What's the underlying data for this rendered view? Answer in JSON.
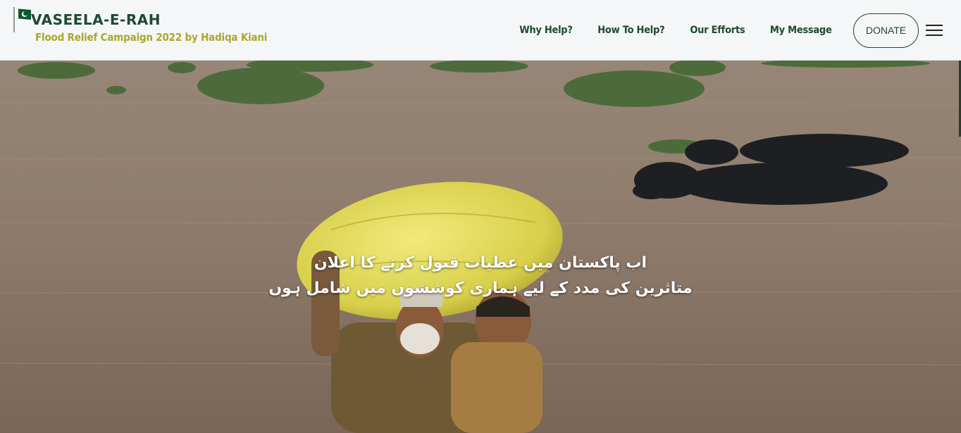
{
  "brand": {
    "name": "VASEELA-E-RAH",
    "tagline": "Flood Relief Campaign 2022 by Hadiqa Kiani",
    "flag_icon": "pakistan-flag-icon"
  },
  "nav": {
    "links": [
      "Why Help?",
      "How To Help?",
      "Our Efforts",
      "My Message"
    ],
    "donate_label": "DONATE",
    "menu_icon": "hamburger-menu-icon"
  },
  "hero": {
    "line1": "اب پاکستان میں عطیات قبول کرنے کا اعلان",
    "line2": "متاثرین کی مدد کے لیے ہماری کوششوں میں شامل ہوں"
  },
  "colors": {
    "brand_green": "#1f4a33",
    "tagline_olive": "#a8a82b",
    "nav_bg": "#f5f6f7"
  }
}
